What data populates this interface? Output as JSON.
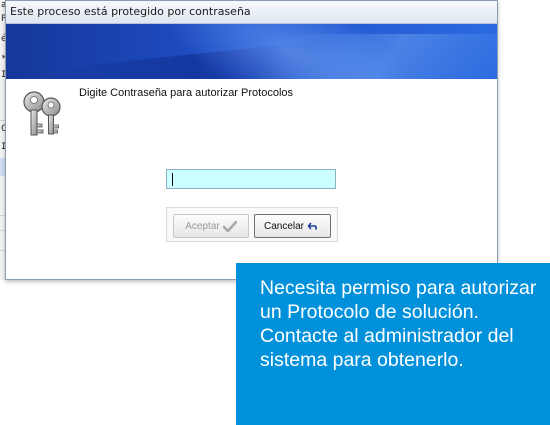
{
  "background_app": {
    "row_chars": [
      "a",
      "P",
      "é",
      "*",
      "I",
      "C",
      "I"
    ]
  },
  "dialog": {
    "title": "Este proceso está protegido por contraseña",
    "icon": "keys-icon",
    "message": "Digite Contraseña para autorizar  Protocolos",
    "password": {
      "value": "",
      "placeholder": "",
      "background_color": "#ccffff"
    },
    "buttons": {
      "accept_label": "Aceptar",
      "accept_icon": "check-icon",
      "accept_enabled": false,
      "cancel_label": "Cancelar",
      "cancel_icon": "undo-icon"
    }
  },
  "tooltip": {
    "text": "Necesita permiso para autorizar un Protocolo de solución. Contacte al administrador del sistema para obtenerlo.",
    "background_color": "#0091da"
  }
}
